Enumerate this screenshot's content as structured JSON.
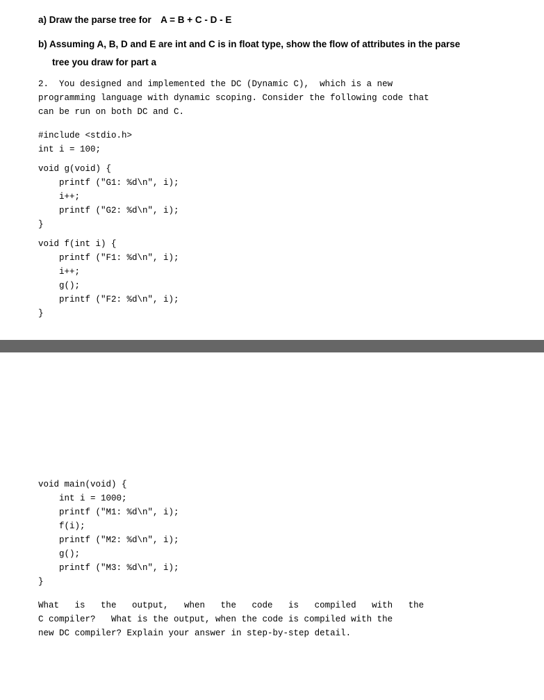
{
  "page": {
    "top_section": {
      "part_a": {
        "label": "a) Draw the parse tree for",
        "formula": "A = B + C - D - E"
      },
      "part_b": {
        "label": "b) Assuming A, B, D and E are int and C is in float type, show the flow of attributes in the parse",
        "label2": "tree you draw for part a"
      },
      "question_2_text": "2.  You designed and implemented the DC (Dynamic C),  which is a new\nprogramming language with dynamic scoping. Consider the following code that\ncan be run on both DC and C.",
      "code_include": "#include <stdio.h>",
      "code_int": "int i = 100;",
      "code_g_func": "void g(void) {\n    printf (\"G1: %d\\n\", i);\n    i++;\n    printf (\"G2: %d\\n\", i);\n}",
      "code_f_func": "void f(int i) {\n    printf (\"F1: %d\\n\", i);\n    i++;\n    g();\n    printf (\"F2: %d\\n\", i);\n}"
    },
    "bottom_section": {
      "code_main_func": "void main(void) {\n    int i = 1000;\n    printf (\"M1: %d\\n\", i);\n    f(i);\n    printf (\"M2: %d\\n\", i);\n    g();\n    printf (\"M3: %d\\n\", i);\n}",
      "answer_text": "What   is   the   output,   when   the   code   is   compiled   with   the\nC compiler?   What is the output, when the code is compiled with the\nnew DC compiler? Explain your answer in step-by-step detail."
    }
  }
}
